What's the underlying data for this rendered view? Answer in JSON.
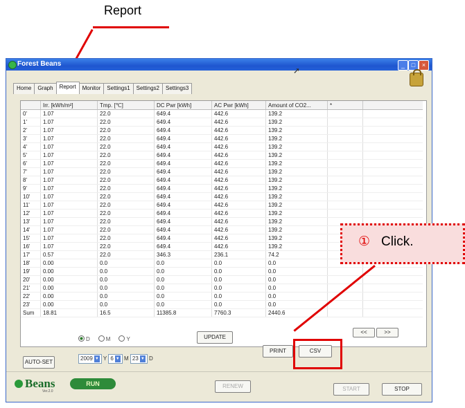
{
  "annotations": {
    "report_callout": "Report",
    "click_number": "①",
    "click_text": "Click."
  },
  "window": {
    "title": "Forest Beans",
    "tabs": [
      "Home",
      "Graph",
      "Report",
      "Monitor",
      "Settings1",
      "Settings2",
      "Settings3"
    ],
    "active_tab": "Report"
  },
  "table": {
    "headers": [
      "",
      "Irr. [kWh/m²]",
      "Tmp. [℃]",
      "DC Pwr [kWh]",
      "AC Pwr [kWh]",
      "Amount of CO2...",
      "*",
      ""
    ],
    "rows": [
      [
        "0'",
        "1.07",
        "22.0",
        "649.4",
        "442.6",
        "139.2",
        "",
        ""
      ],
      [
        "1'",
        "1.07",
        "22.0",
        "649.4",
        "442.6",
        "139.2",
        "",
        ""
      ],
      [
        "2'",
        "1.07",
        "22.0",
        "649.4",
        "442.6",
        "139.2",
        "",
        ""
      ],
      [
        "3'",
        "1.07",
        "22.0",
        "649.4",
        "442.6",
        "139.2",
        "",
        ""
      ],
      [
        "4'",
        "1.07",
        "22.0",
        "649.4",
        "442.6",
        "139.2",
        "",
        ""
      ],
      [
        "5'",
        "1.07",
        "22.0",
        "649.4",
        "442.6",
        "139.2",
        "",
        ""
      ],
      [
        "6'",
        "1.07",
        "22.0",
        "649.4",
        "442.6",
        "139.2",
        "",
        ""
      ],
      [
        "7'",
        "1.07",
        "22.0",
        "649.4",
        "442.6",
        "139.2",
        "",
        ""
      ],
      [
        "8'",
        "1.07",
        "22.0",
        "649.4",
        "442.6",
        "139.2",
        "",
        ""
      ],
      [
        "9'",
        "1.07",
        "22.0",
        "649.4",
        "442.6",
        "139.2",
        "",
        ""
      ],
      [
        "10'",
        "1.07",
        "22.0",
        "649.4",
        "442.6",
        "139.2",
        "",
        ""
      ],
      [
        "11'",
        "1.07",
        "22.0",
        "649.4",
        "442.6",
        "139.2",
        "",
        ""
      ],
      [
        "12'",
        "1.07",
        "22.0",
        "649.4",
        "442.6",
        "139.2",
        "",
        ""
      ],
      [
        "13'",
        "1.07",
        "22.0",
        "649.4",
        "442.6",
        "139.2",
        "",
        ""
      ],
      [
        "14'",
        "1.07",
        "22.0",
        "649.4",
        "442.6",
        "139.2",
        "",
        ""
      ],
      [
        "15'",
        "1.07",
        "22.0",
        "649.4",
        "442.6",
        "139.2",
        "",
        ""
      ],
      [
        "16'",
        "1.07",
        "22.0",
        "649.4",
        "442.6",
        "139.2",
        "",
        ""
      ],
      [
        "17'",
        "0.57",
        "22.0",
        "346.3",
        "236.1",
        "74.2",
        "",
        ""
      ],
      [
        "18'",
        "0.00",
        "0.0",
        "0.0",
        "0.0",
        "0.0",
        "",
        ""
      ],
      [
        "19'",
        "0.00",
        "0.0",
        "0.0",
        "0.0",
        "0.0",
        "",
        ""
      ],
      [
        "20'",
        "0.00",
        "0.0",
        "0.0",
        "0.0",
        "0.0",
        "",
        ""
      ],
      [
        "21'",
        "0.00",
        "0.0",
        "0.0",
        "0.0",
        "0.0",
        "",
        ""
      ],
      [
        "22'",
        "0.00",
        "0.0",
        "0.0",
        "0.0",
        "0.0",
        "",
        ""
      ],
      [
        "23'",
        "0.00",
        "0.0",
        "0.0",
        "0.0",
        "0.0",
        "",
        ""
      ],
      [
        "Sum",
        "18.81",
        "16.5",
        "11385.8",
        "7760.3",
        "2440.6",
        "",
        ""
      ]
    ]
  },
  "controls": {
    "autoset": "AUTO-SET",
    "radios": [
      {
        "label": "D",
        "checked": true
      },
      {
        "label": "M",
        "checked": false
      },
      {
        "label": "Y",
        "checked": false
      }
    ],
    "year_value": "2009",
    "year_unit": "Y",
    "month_value": "6",
    "month_unit": "M",
    "day_value": "23",
    "day_unit": "D",
    "update": "UPDATE",
    "prev": "<<",
    "next": ">>",
    "print": "PRINT",
    "csv": "CSV"
  },
  "footer": {
    "logo": "Beans",
    "version": "Ver.2.0",
    "run": "RUN",
    "renew": "RENEW",
    "start": "START",
    "stop": "STOP"
  },
  "colors": {
    "highlight": "#e00000",
    "callout_fill": "#f9dddd",
    "titlebar": "#1f56cf",
    "window_bg": "#ece9d8"
  }
}
